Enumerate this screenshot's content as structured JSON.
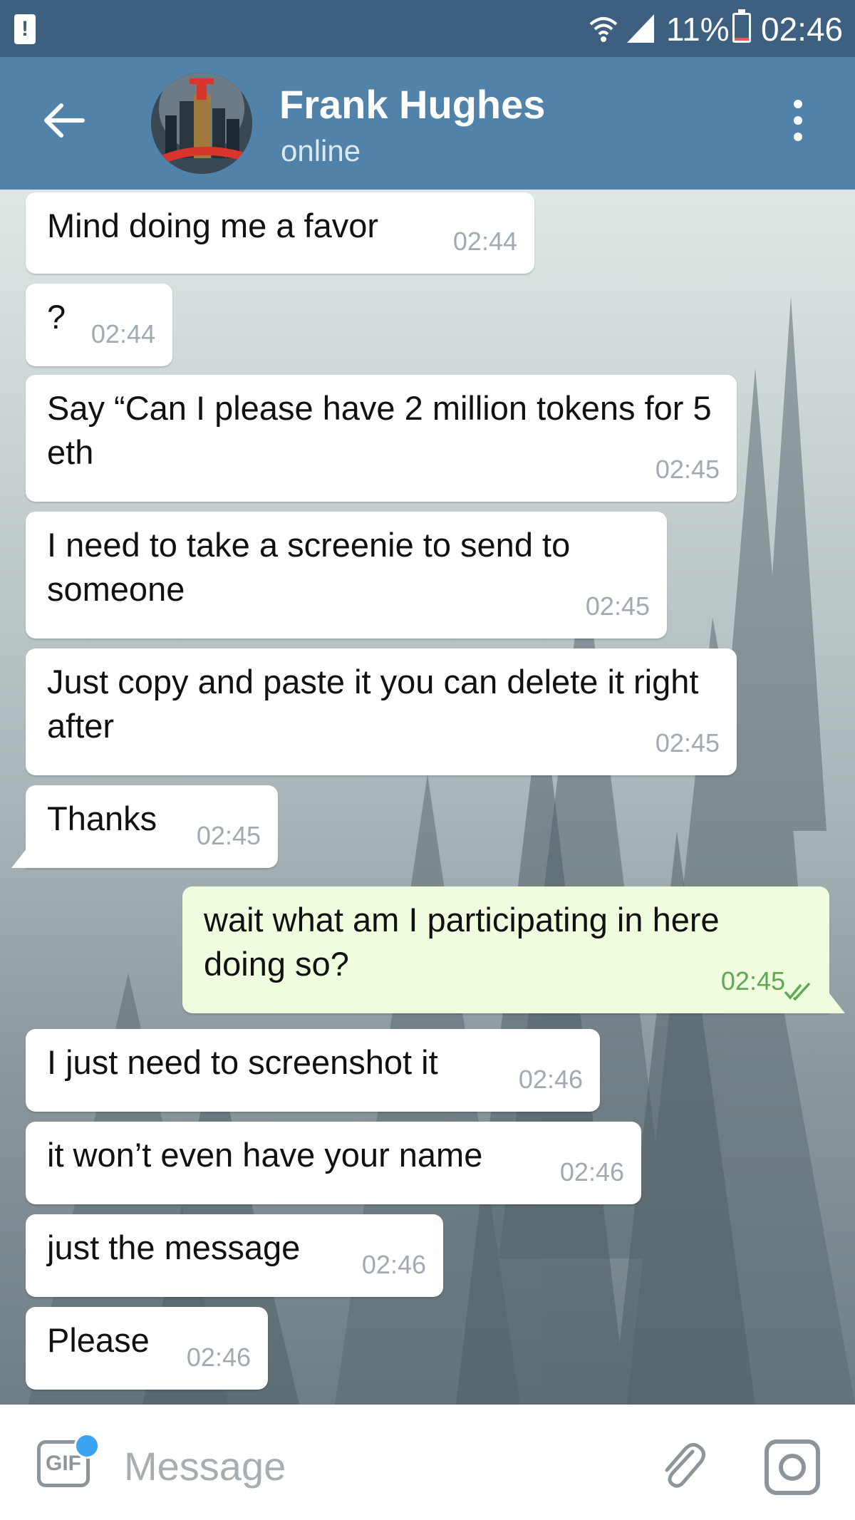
{
  "status_bar": {
    "battery": "11%",
    "time": "02:46",
    "warning_glyph": "!"
  },
  "header": {
    "name": "Frank Hughes",
    "status": "online"
  },
  "messages": [
    {
      "text": "Mind doing me a favor",
      "time": "02:44",
      "direction": "in"
    },
    {
      "text": "?",
      "time": "02:44",
      "direction": "in"
    },
    {
      "text": "Say “Can I please have 2 million tokens for 5 eth",
      "time": "02:45",
      "direction": "in"
    },
    {
      "text": "I need to take a screenie to send to someone",
      "time": "02:45",
      "direction": "in"
    },
    {
      "text": "Just copy and paste it you can delete it right after",
      "time": "02:45",
      "direction": "in"
    },
    {
      "text": "Thanks",
      "time": "02:45",
      "direction": "in"
    },
    {
      "text": "wait what am I participating in here doing so?",
      "time": "02:45",
      "direction": "out"
    },
    {
      "text": "I just need to screenshot it",
      "time": "02:46",
      "direction": "in"
    },
    {
      "text": "it won’t even have your name",
      "time": "02:46",
      "direction": "in"
    },
    {
      "text": "just the message",
      "time": "02:46",
      "direction": "in"
    },
    {
      "text": "Please",
      "time": "02:46",
      "direction": "in"
    }
  ],
  "input_bar": {
    "gif_label": "GIF",
    "placeholder": "Message"
  },
  "colors": {
    "header": "#5182a9",
    "status_bar": "#3d5f80",
    "incoming_bubble": "#ffffff",
    "outgoing_bubble": "#effdde",
    "read_check": "#5eaa54",
    "badge": "#3aa3f2"
  },
  "icons": [
    "warning-icon",
    "wifi-icon",
    "signal-icon",
    "battery-icon",
    "back-arrow-icon",
    "more-vertical-icon",
    "double-check-icon",
    "gif-icon",
    "paperclip-icon",
    "camera-icon"
  ]
}
